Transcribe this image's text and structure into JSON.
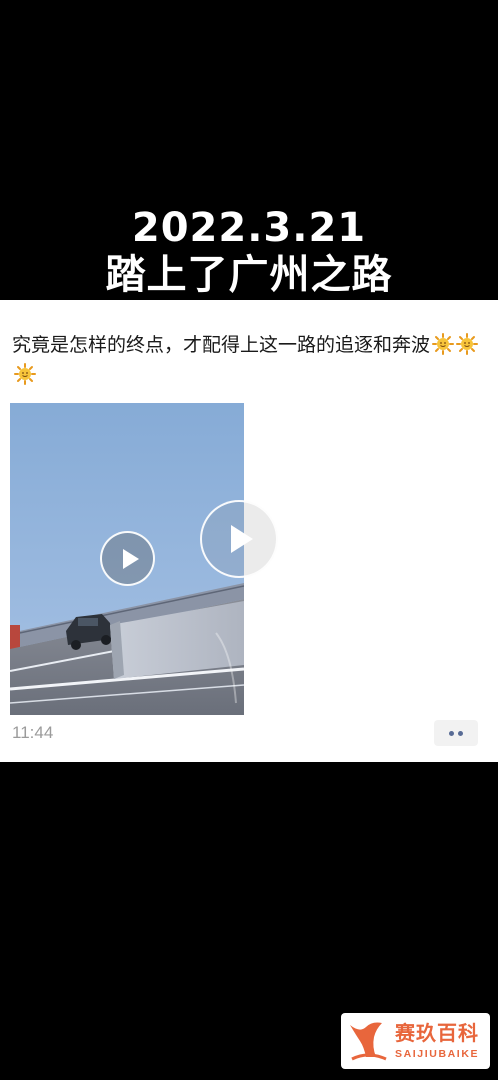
{
  "overlay": {
    "date": "2022.3.21",
    "title": "踏上了广州之路"
  },
  "post": {
    "text": "究竟是怎样的终点，才配得上这一路的追逐和奔波",
    "emoji": [
      "sun-emoji",
      "sun-emoji",
      "sun-emoji"
    ],
    "time": "11:44"
  },
  "watermark": {
    "name_cn": "赛玖百科",
    "name_en": "SAIJIUBAIKE"
  },
  "colors": {
    "background": "#000000",
    "card": "#ffffff",
    "link_blue": "#576b95",
    "watermark_orange": "#e8663c"
  }
}
